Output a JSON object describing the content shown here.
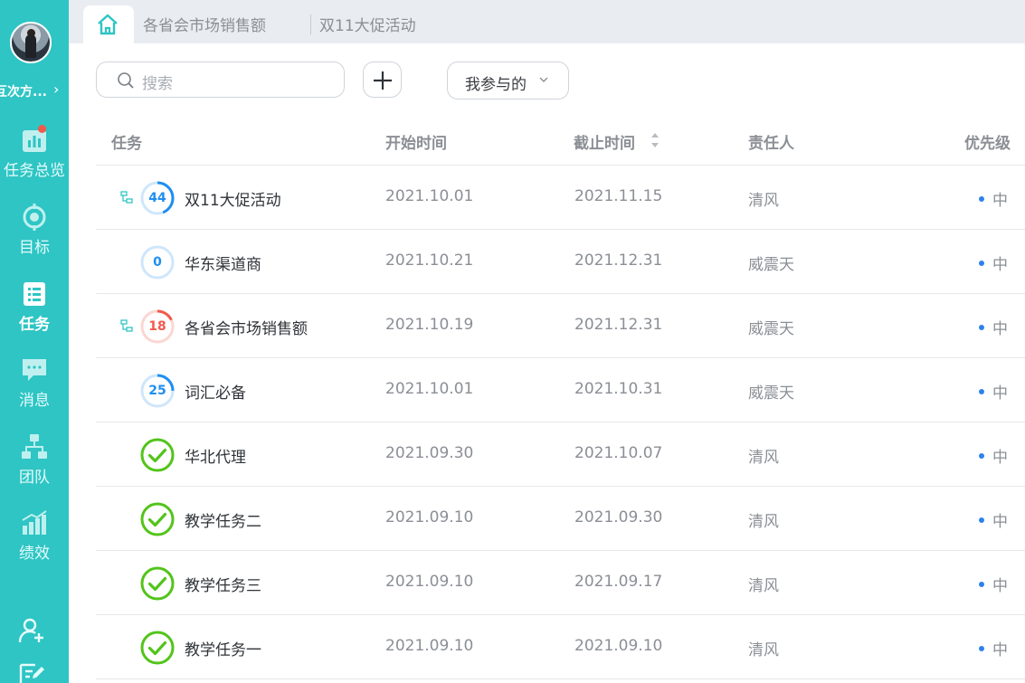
{
  "sidebar": {
    "org_name": "互次方...",
    "chevron": "›",
    "items": [
      {
        "label": "任务总览",
        "icon": "chart-icon",
        "badge": true
      },
      {
        "label": "目标",
        "icon": "target-icon"
      },
      {
        "label": "任务",
        "icon": "task-list-icon",
        "active": true
      },
      {
        "label": "消息",
        "icon": "message-icon"
      },
      {
        "label": "团队",
        "icon": "team-icon"
      },
      {
        "label": "绩效",
        "icon": "performance-icon"
      }
    ],
    "bottom_icons": [
      "add-member-icon",
      "edit-icon"
    ]
  },
  "tabs": {
    "home_icon": "home-icon",
    "items": [
      {
        "label": "各省会市场销售额"
      },
      {
        "label": "双11大促活动"
      }
    ]
  },
  "toolbar": {
    "search_placeholder": "搜索",
    "add_icon": "plus-icon",
    "filter_label": "我参与的",
    "filter_icon": "chevron-down-icon"
  },
  "table": {
    "columns": {
      "task": "任务",
      "start": "开始时间",
      "end": "截止时间",
      "owner": "责任人",
      "priority": "优先级"
    },
    "rows": [
      {
        "name": "双11大促活动",
        "progress": "44",
        "progress_value": 44,
        "state": "progress",
        "has_children": true,
        "start": "2021.10.01",
        "end": "2021.11.15",
        "owner": "清风",
        "priority": "中"
      },
      {
        "name": "华东渠道商",
        "progress": "0",
        "progress_value": 0,
        "state": "progress",
        "has_children": false,
        "start": "2021.10.21",
        "end": "2021.12.31",
        "owner": "威震天",
        "priority": "中"
      },
      {
        "name": "各省会市场销售额",
        "progress": "18",
        "progress_value": 18,
        "state": "overdue",
        "has_children": true,
        "start": "2021.10.19",
        "end": "2021.12.31",
        "owner": "威震天",
        "priority": "中"
      },
      {
        "name": "词汇必备",
        "progress": "25",
        "progress_value": 25,
        "state": "progress",
        "has_children": false,
        "start": "2021.10.01",
        "end": "2021.10.31",
        "owner": "威震天",
        "priority": "中"
      },
      {
        "name": "华北代理",
        "progress": "",
        "progress_value": 100,
        "state": "done",
        "has_children": false,
        "start": "2021.09.30",
        "end": "2021.10.07",
        "owner": "清风",
        "priority": "中"
      },
      {
        "name": "教学任务二",
        "progress": "",
        "progress_value": 100,
        "state": "done",
        "has_children": false,
        "start": "2021.09.10",
        "end": "2021.09.30",
        "owner": "清风",
        "priority": "中"
      },
      {
        "name": "教学任务三",
        "progress": "",
        "progress_value": 100,
        "state": "done",
        "has_children": false,
        "start": "2021.09.10",
        "end": "2021.09.17",
        "owner": "清风",
        "priority": "中"
      },
      {
        "name": "教学任务一",
        "progress": "",
        "progress_value": 100,
        "state": "done",
        "has_children": false,
        "start": "2021.09.10",
        "end": "2021.09.10",
        "owner": "清风",
        "priority": "中"
      }
    ]
  },
  "colors": {
    "sidebar_bg": "#2ec5c4",
    "progress_blue": "#1f8ef1",
    "progress_track": "#cfe6fb",
    "overdue_red": "#f2594b",
    "overdue_track": "#fbd6d2",
    "done_green": "#52c41a",
    "priority_dot": "#2f80ed"
  }
}
